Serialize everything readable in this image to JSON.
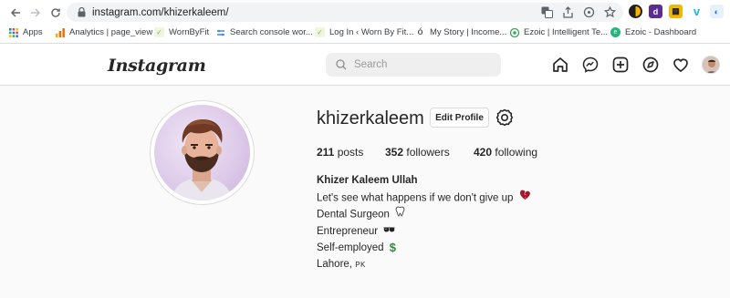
{
  "browser": {
    "url": "instagram.com/khizerkaleem/",
    "bookmarks": [
      {
        "label": "Apps"
      },
      {
        "label": "Analytics | page_view"
      },
      {
        "label": "WornByFit"
      },
      {
        "label": "Search console wor..."
      },
      {
        "label": "Log In ‹ Worn By Fit..."
      },
      {
        "label": "My Story | Income..."
      },
      {
        "label": "Ezoic | Intelligent Te..."
      },
      {
        "label": "Ezoic - Dashboard"
      }
    ]
  },
  "header": {
    "logo": "Instagram",
    "search_placeholder": "Search"
  },
  "profile": {
    "username": "khizerkaleem",
    "edit_label": "Edit Profile",
    "stats": {
      "posts": "211",
      "posts_label": "posts",
      "followers": "352",
      "followers_label": "followers",
      "following": "420",
      "following_label": "following"
    },
    "bio": {
      "name": "Khizer Kaleem Ullah",
      "line1": "Let's see what happens if we don't give up",
      "line2": "Dental Surgeon",
      "line3": "Entrepreneur",
      "line4": "Self-employed",
      "line5": "Lahore,",
      "line5_suffix": "PK"
    }
  },
  "colors": {
    "accent": "#262626",
    "border": "#dbdbdb",
    "bg": "#fafafa"
  }
}
